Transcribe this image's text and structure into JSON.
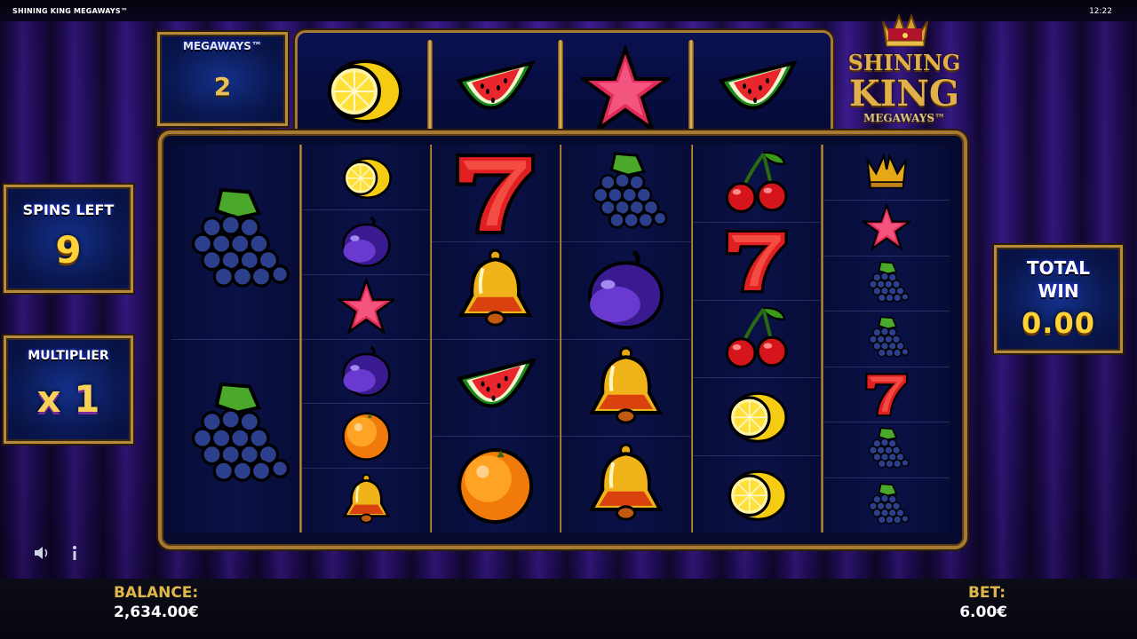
{
  "top_bar": {
    "game_name": "SHINING KING MEGAWAYS™",
    "clock": "12:22"
  },
  "megaways": {
    "label": "MEGAWAYS™",
    "value": "2"
  },
  "spins_left": {
    "label": "SPINS LEFT",
    "value": "9"
  },
  "multiplier": {
    "label": "MULTIPLIER",
    "value": "x 1"
  },
  "total_win": {
    "label_line1": "TOTAL",
    "label_line2": "WIN",
    "value": "0.00"
  },
  "logo": {
    "line1": "SHINING",
    "line2": "KING",
    "line3": "MEGAWAYS™"
  },
  "top_reel": [
    "lemon",
    "watermelon",
    "star",
    "watermelon"
  ],
  "reels": [
    [
      "grapes",
      "grapes"
    ],
    [
      "lemon",
      "plum",
      "star",
      "plum",
      "orange",
      "bell"
    ],
    [
      "seven",
      "bell",
      "watermelon",
      "orange"
    ],
    [
      "grapes",
      "plum",
      "bell",
      "bell"
    ],
    [
      "cherries",
      "seven",
      "cherries",
      "lemon",
      "lemon"
    ],
    [
      "crown",
      "star",
      "grapes",
      "grapes",
      "seven",
      "grapes",
      "grapes"
    ]
  ],
  "bottom_bar": {
    "balance_label": "BALANCE:",
    "balance_value": "2,634.00€",
    "bet_label": "BET:",
    "bet_value": "6.00€"
  },
  "controls": {
    "sound_icon": "speaker-icon",
    "info_icon": "info-icon"
  },
  "colors": {
    "gold": "#b88a3e",
    "panel_blue": "#0b1a55",
    "value_yellow": "#ffd23a",
    "curtain": "#2d1377"
  }
}
